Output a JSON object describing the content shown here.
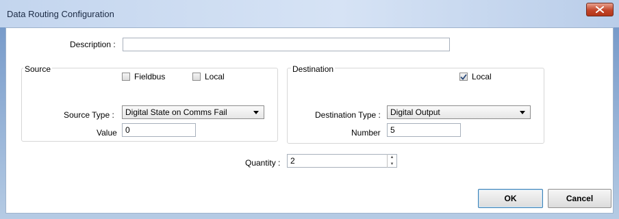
{
  "window": {
    "title": "Data Routing Configuration"
  },
  "description": {
    "label": "Description :",
    "value": ""
  },
  "source": {
    "group_title": "Source",
    "fieldbus_label": "Fieldbus",
    "fieldbus_checked": false,
    "local_label": "Local",
    "local_checked": false,
    "type_label": "Source Type :",
    "type_value": "Digital State on Comms Fail",
    "value_label": "Value",
    "value_value": "0"
  },
  "destination": {
    "group_title": "Destination",
    "local_label": "Local",
    "local_checked": true,
    "type_label": "Destination Type :",
    "type_value": "Digital Output",
    "number_label": "Number",
    "number_value": "5"
  },
  "quantity": {
    "label": "Quantity :",
    "value": "2"
  },
  "buttons": {
    "ok_label": "OK",
    "cancel_label": "Cancel"
  },
  "colors": {
    "title_bar": "#c3d5ee",
    "close_button": "#c2452a",
    "default_button_border": "#3c7fb1"
  }
}
